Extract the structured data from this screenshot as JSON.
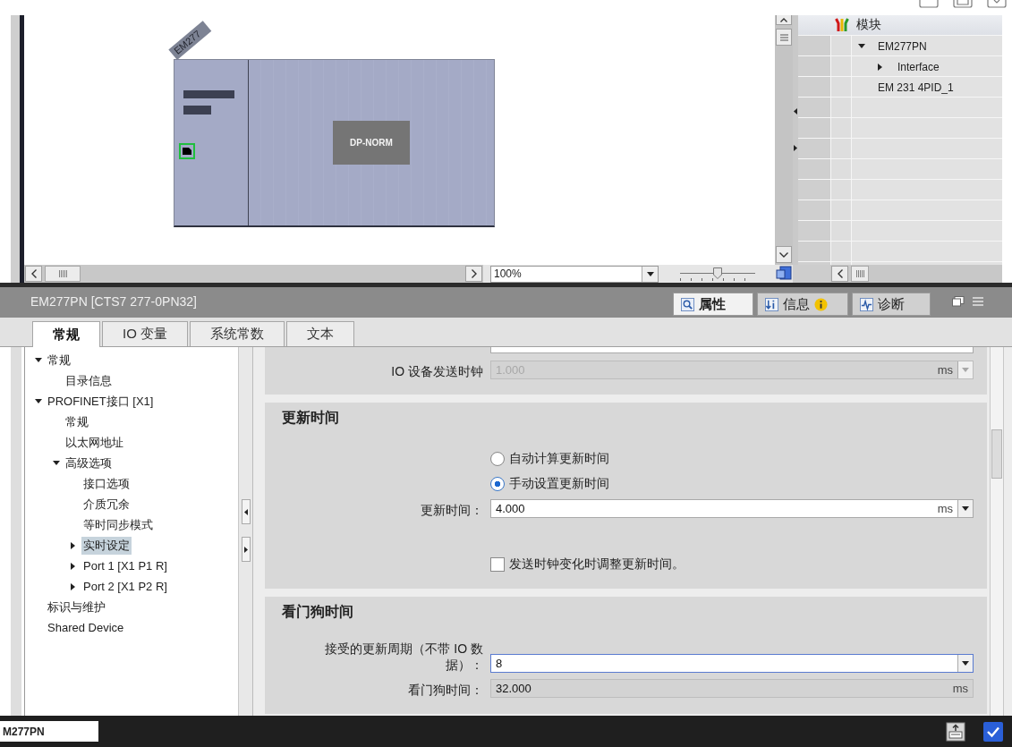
{
  "canvas": {
    "device": {
      "tag": "EM277",
      "module": "DP-NORM"
    },
    "zoom_value": "100%",
    "zoom_slider": {
      "level": 0.5
    }
  },
  "device_overview": {
    "column_header": "模块",
    "rows": [
      {
        "name": "EM277PN",
        "kind": "folder",
        "expanded": true,
        "children": [
          {
            "name": "Interface",
            "kind": "folder",
            "expanded": false
          }
        ]
      },
      {
        "name": "EM 231 4PID_1",
        "kind": "leaf"
      }
    ]
  },
  "inspector": {
    "title": "EM277PN [CTS7 277-0PN32]",
    "view_tabs": [
      {
        "label": "属性",
        "kind": "properties",
        "selected": true,
        "notice": false
      },
      {
        "label": "信息",
        "kind": "info",
        "selected": false,
        "notice": true
      },
      {
        "label": "诊断",
        "kind": "diagnostics",
        "selected": false,
        "notice": false
      }
    ],
    "tabs": [
      {
        "label": "常规",
        "selected": true
      },
      {
        "label": "IO 变量",
        "selected": false
      },
      {
        "label": "系统常数",
        "selected": false
      },
      {
        "label": "文本",
        "selected": false
      }
    ],
    "nav_tree": [
      {
        "label": "常规",
        "kind": "folder",
        "expanded": true,
        "selected": false,
        "children": [
          {
            "label": "目录信息",
            "kind": "leaf",
            "selected": false
          }
        ]
      },
      {
        "label": "PROFINET接口 [X1]",
        "kind": "folder",
        "expanded": true,
        "selected": false,
        "children": [
          {
            "label": "常规",
            "kind": "leaf",
            "selected": false
          },
          {
            "label": "以太网地址",
            "kind": "leaf",
            "selected": false
          },
          {
            "label": "高级选项",
            "kind": "folder",
            "expanded": true,
            "selected": false,
            "children": [
              {
                "label": "接口选项",
                "kind": "leaf",
                "selected": false
              },
              {
                "label": "介质冗余",
                "kind": "leaf",
                "selected": false
              },
              {
                "label": "等时同步模式",
                "kind": "leaf",
                "selected": false
              },
              {
                "label": "实时设定",
                "kind": "folder",
                "expanded": false,
                "selected": true
              },
              {
                "label": "Port 1 [X1 P1 R]",
                "kind": "folder",
                "expanded": false,
                "selected": false
              },
              {
                "label": "Port 2 [X1 P2 R]",
                "kind": "folder",
                "expanded": false,
                "selected": false
              }
            ]
          }
        ]
      },
      {
        "label": "标识与维护",
        "kind": "leaf",
        "selected": false
      },
      {
        "label": "Shared Device",
        "kind": "leaf",
        "selected": false
      }
    ],
    "sections": [
      {
        "rows": [
          {
            "kind": "clipped"
          },
          {
            "kind": "field",
            "label": "IO 设备发送时钟",
            "value": "1.000",
            "unit": "ms",
            "disabled": true,
            "editable": false,
            "focused": false,
            "dropdown": true
          }
        ]
      },
      {
        "title": "更新时间",
        "rows": [
          {
            "kind": "radio",
            "label": "自动计算更新时间",
            "selected": false
          },
          {
            "kind": "radio",
            "label": "手动设置更新时间",
            "selected": true
          },
          {
            "kind": "field",
            "label": "更新时间：",
            "value": "4.000",
            "unit": "ms",
            "disabled": false,
            "editable": true,
            "focused": false,
            "dropdown": true
          },
          {
            "kind": "checkbox",
            "label": "发送时钟变化时调整更新时间。",
            "checked": false
          }
        ]
      },
      {
        "title": "看门狗时间",
        "rows": [
          {
            "kind": "field",
            "label": "接受的更新周期（不带 IO 数据）：",
            "value": "8",
            "disabled": false,
            "editable": true,
            "focused": true,
            "dropdown": true
          },
          {
            "kind": "field",
            "label": "看门狗时间：",
            "value": "32.000",
            "unit": "ms",
            "disabled": false,
            "editable": false,
            "focused": false,
            "dropdown": false
          }
        ]
      }
    ]
  },
  "status_bar": {
    "name_field": "M277PN"
  }
}
